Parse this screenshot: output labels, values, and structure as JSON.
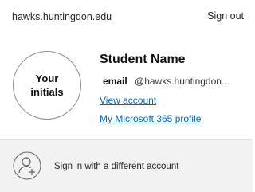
{
  "header": {
    "organization": "hawks.huntingdon.edu",
    "sign_out_label": "Sign out"
  },
  "profile": {
    "avatar_text_line1": "Your",
    "avatar_text_line2": "initials",
    "name": "Student Name",
    "email_label": "email",
    "email_value": "@hawks.huntingdon...",
    "view_account_label": "View account",
    "m365_profile_label": "My Microsoft 365 profile"
  },
  "switch_account": {
    "label": "Sign in with a different account",
    "icon": "person-add-icon"
  },
  "colors": {
    "link": "#0067b8",
    "footer_background": "#f2f2f2"
  }
}
